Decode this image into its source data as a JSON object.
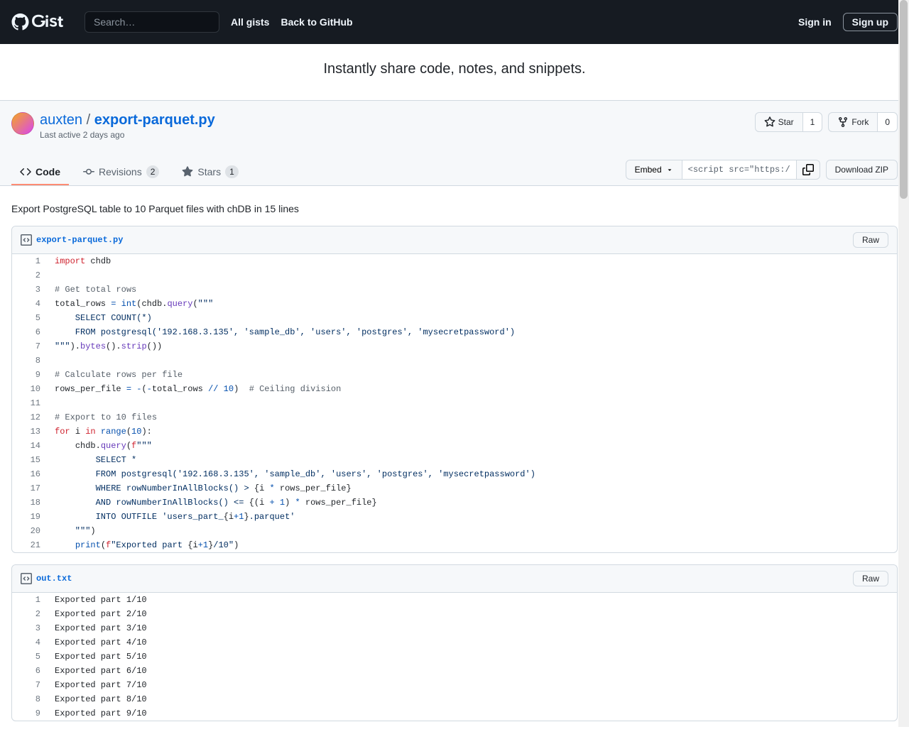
{
  "header": {
    "search_placeholder": "Search…",
    "nav": {
      "all_gists": "All gists",
      "back": "Back to GitHub"
    },
    "signin": "Sign in",
    "signup": "Sign up"
  },
  "tagline": "Instantly share code, notes, and snippets.",
  "gist": {
    "author": "auxten",
    "sep": "/",
    "filename": "export-parquet.py",
    "meta": "Last active 2 days ago"
  },
  "actions": {
    "star_label": "Star",
    "star_count": "1",
    "fork_label": "Fork",
    "fork_count": "0"
  },
  "tabs": {
    "code": "Code",
    "revisions": "Revisions",
    "revisions_count": "2",
    "stars": "Stars",
    "stars_count": "1"
  },
  "toolbar": {
    "embed": "Embed",
    "embed_value": "<script src=\"https:/",
    "download": "Download ZIP"
  },
  "description": "Export PostgreSQL table to 10 Parquet files with chDB in 15 lines",
  "file1": {
    "name": "export-parquet.py",
    "raw": "Raw",
    "lines": [
      {
        "n": "1",
        "h": "<span class='k'>import</span> <span>chdb</span>"
      },
      {
        "n": "2",
        "h": ""
      },
      {
        "n": "3",
        "h": "<span class='c'># Get total rows</span>"
      },
      {
        "n": "4",
        "h": "<span>total_rows</span> <span class='op'>=</span> <span class='nb'>int</span>(<span>chdb</span>.<span class='fn'>query</span>(<span class='s'>\"\"\"</span>"
      },
      {
        "n": "5",
        "h": "<span class='s'>    SELECT COUNT(*)</span>"
      },
      {
        "n": "6",
        "h": "<span class='s'>    FROM postgresql('192.168.3.135', 'sample_db', 'users', 'postgres', 'mysecretpassword')</span>"
      },
      {
        "n": "7",
        "h": "<span class='s'>\"\"\"</span>).<span class='fn'>bytes</span>().<span class='fn'>strip</span>())"
      },
      {
        "n": "8",
        "h": ""
      },
      {
        "n": "9",
        "h": "<span class='c'># Calculate rows per file</span>"
      },
      {
        "n": "10",
        "h": "<span>rows_per_file</span> <span class='op'>=</span> <span class='op'>-</span>(<span class='op'>-</span><span>total_rows</span> <span class='op'>//</span> <span class='n'>10</span>)  <span class='c'># Ceiling division</span>"
      },
      {
        "n": "11",
        "h": ""
      },
      {
        "n": "12",
        "h": "<span class='c'># Export to 10 files</span>"
      },
      {
        "n": "13",
        "h": "<span class='k'>for</span> <span>i</span> <span class='k'>in</span> <span class='nb'>range</span>(<span class='n'>10</span>):"
      },
      {
        "n": "14",
        "h": "    <span>chdb</span>.<span class='fn'>query</span>(<span class='k'>f</span><span class='s'>\"\"\"</span>"
      },
      {
        "n": "15",
        "h": "<span class='s'>        SELECT *</span>"
      },
      {
        "n": "16",
        "h": "<span class='s'>        FROM postgresql('192.168.3.135', 'sample_db', 'users', 'postgres', 'mysecretpassword')</span>"
      },
      {
        "n": "17",
        "h": "<span class='s'>        WHERE rowNumberInAllBlocks() &gt; </span>{<span>i</span> <span class='op'>*</span> <span>rows_per_file</span>}<span class='s'></span>"
      },
      {
        "n": "18",
        "h": "<span class='s'>        AND rowNumberInAllBlocks() &lt;= </span>{(<span>i</span> <span class='op'>+</span> <span class='n'>1</span>) <span class='op'>*</span> <span>rows_per_file</span>}<span class='s'></span>"
      },
      {
        "n": "19",
        "h": "<span class='s'>        INTO OUTFILE 'users_part_</span>{<span>i</span><span class='op'>+</span><span class='n'>1</span>}<span class='s'>.parquet'</span>"
      },
      {
        "n": "20",
        "h": "<span class='s'>    \"\"\"</span>)"
      },
      {
        "n": "21",
        "h": "    <span class='nb'>print</span>(<span class='k'>f</span><span class='s'>\"Exported part </span>{<span>i</span><span class='op'>+</span><span class='n'>1</span>}<span class='s'>/10\"</span>)"
      }
    ]
  },
  "file2": {
    "name": "out.txt",
    "raw": "Raw",
    "lines": [
      {
        "n": "1",
        "t": "Exported part 1/10"
      },
      {
        "n": "2",
        "t": "Exported part 2/10"
      },
      {
        "n": "3",
        "t": "Exported part 3/10"
      },
      {
        "n": "4",
        "t": "Exported part 4/10"
      },
      {
        "n": "5",
        "t": "Exported part 5/10"
      },
      {
        "n": "6",
        "t": "Exported part 6/10"
      },
      {
        "n": "7",
        "t": "Exported part 7/10"
      },
      {
        "n": "8",
        "t": "Exported part 8/10"
      },
      {
        "n": "9",
        "t": "Exported part 9/10"
      }
    ]
  }
}
